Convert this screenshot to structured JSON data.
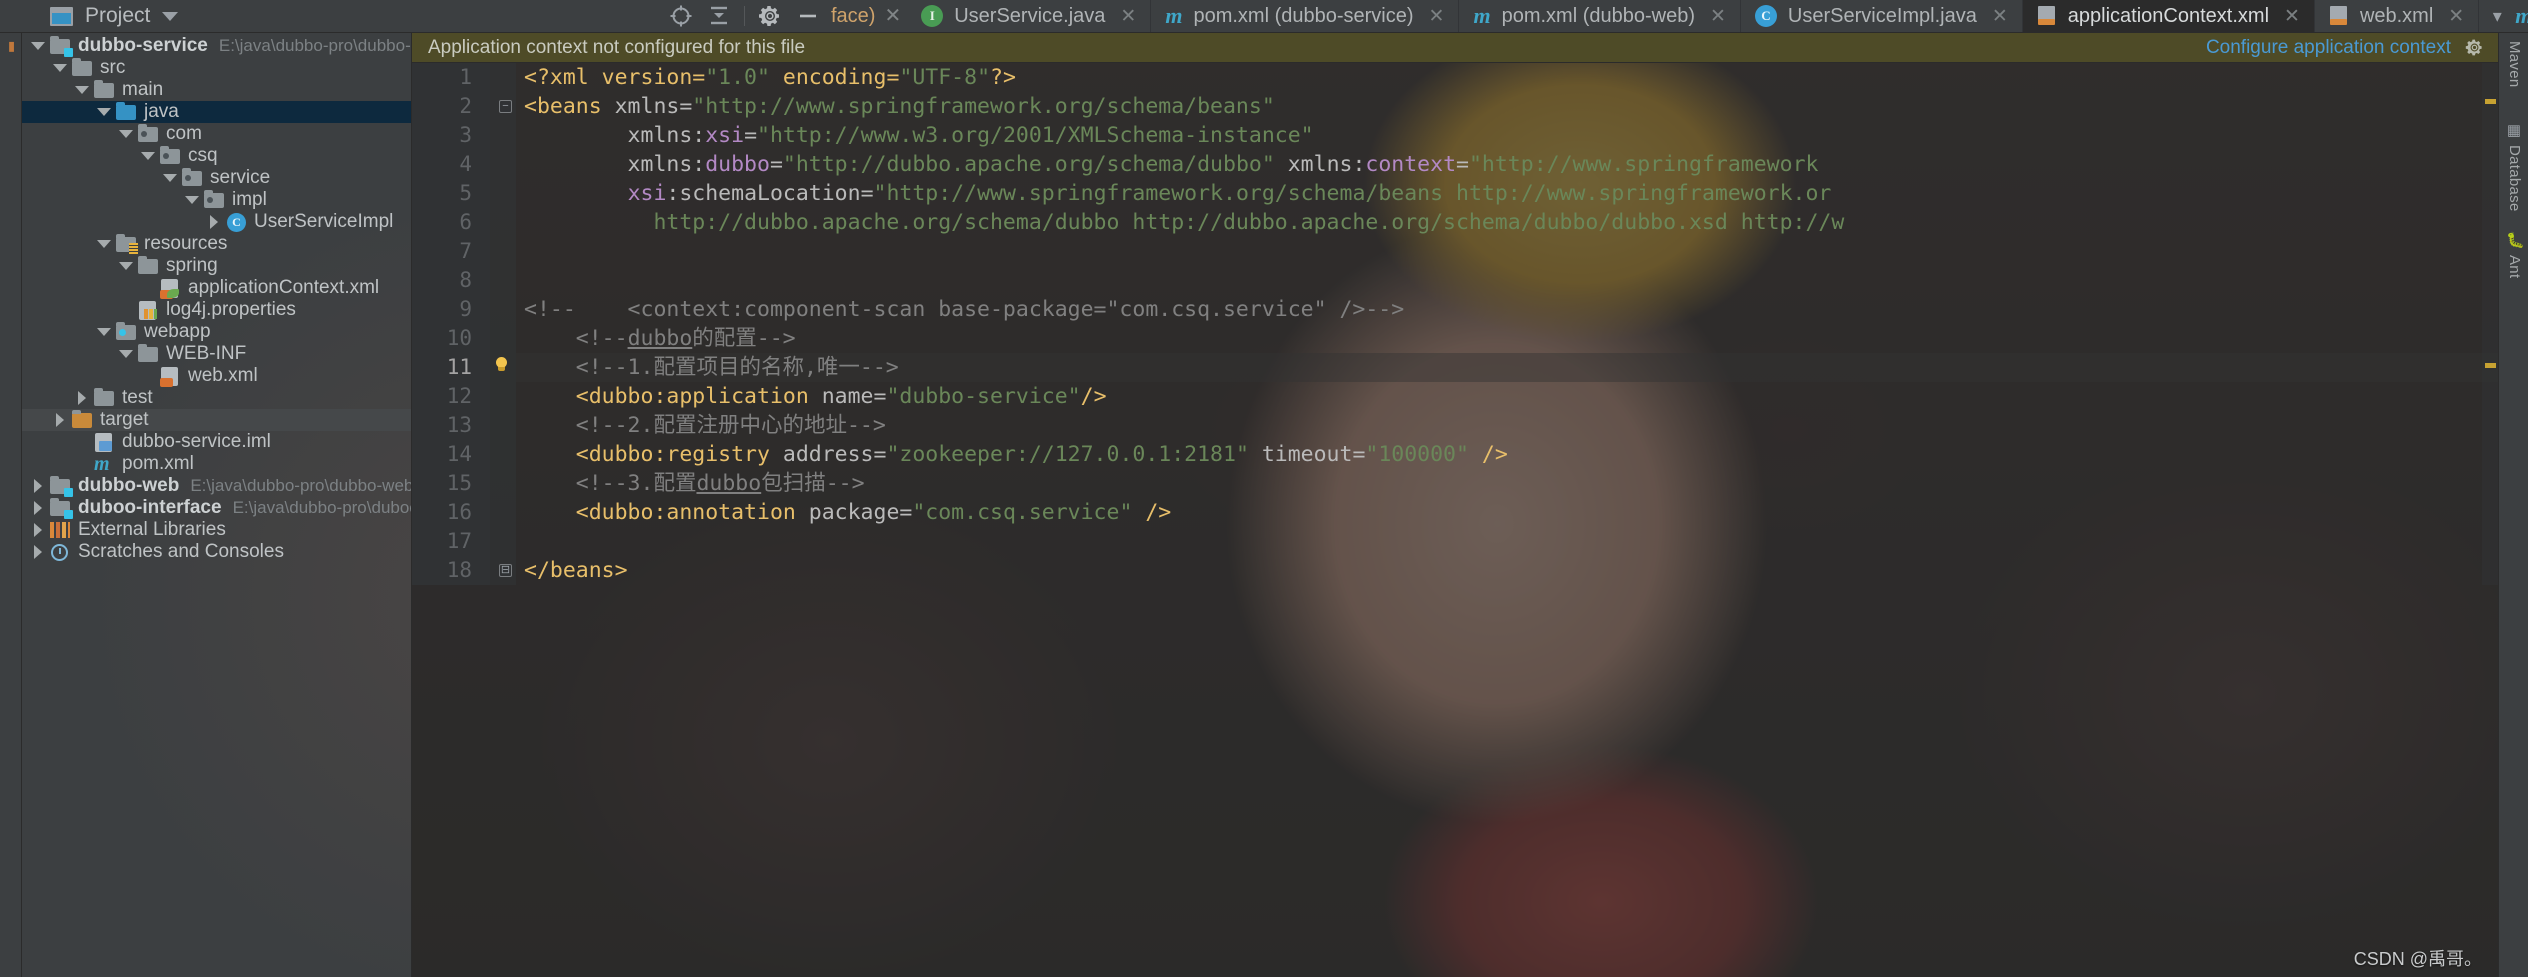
{
  "toolbar": {
    "project_button_label": "Project",
    "icons": [
      {
        "name": "locate-icon",
        "glyph": "target"
      },
      {
        "name": "collapse-all-icon",
        "glyph": "collapse"
      },
      {
        "name": "settings-gear-icon",
        "glyph": "gear"
      },
      {
        "name": "hide-icon",
        "glyph": "minus"
      }
    ],
    "clipped_tab_label": "face)"
  },
  "tabs": [
    {
      "label": "UserService.java",
      "icon": "java-interface-icon",
      "icon_kind": "java",
      "active": false
    },
    {
      "label": "pom.xml (dubbo-service)",
      "icon": "maven-icon",
      "icon_kind": "maven",
      "active": false
    },
    {
      "label": "pom.xml (dubbo-web)",
      "icon": "maven-icon",
      "icon_kind": "maven",
      "active": false
    },
    {
      "label": "UserServiceImpl.java",
      "icon": "java-class-icon",
      "icon_kind": "class",
      "active": false
    },
    {
      "label": "applicationContext.xml",
      "icon": "xml-file-icon",
      "icon_kind": "xml",
      "active": true
    },
    {
      "label": "web.xml",
      "icon": "xml-file-icon",
      "icon_kind": "xml",
      "active": false
    }
  ],
  "tabs_overflow_icon": "chevron-down-icon",
  "notification": {
    "message": "Application context not configured for this file",
    "link": "Configure application context",
    "gear_icon": "gear-icon",
    "background_color": "#4e4b27",
    "link_color": "#4a9ad4"
  },
  "sidebar": {
    "title": "Project",
    "rows": [
      {
        "depth": 0,
        "arrow": "down",
        "icon": "module-folder-icon",
        "label": "dubbo-service",
        "bold": true,
        "path": "E:\\java\\dubbo-pro\\dubbo-service",
        "state": "normal"
      },
      {
        "depth": 1,
        "arrow": "down",
        "icon": "folder-icon",
        "label": "src",
        "state": "normal"
      },
      {
        "depth": 2,
        "arrow": "down",
        "icon": "folder-icon",
        "label": "main",
        "state": "normal"
      },
      {
        "depth": 3,
        "arrow": "down",
        "icon": "source-folder-icon",
        "label": "java",
        "state": "selected"
      },
      {
        "depth": 4,
        "arrow": "down",
        "icon": "package-folder-icon",
        "label": "com",
        "state": "normal"
      },
      {
        "depth": 5,
        "arrow": "down",
        "icon": "package-folder-icon",
        "label": "csq",
        "state": "normal"
      },
      {
        "depth": 6,
        "arrow": "down",
        "icon": "package-folder-icon",
        "label": "service",
        "state": "normal"
      },
      {
        "depth": 7,
        "arrow": "down",
        "icon": "package-folder-icon",
        "label": "impl",
        "state": "normal"
      },
      {
        "depth": 8,
        "arrow": "right",
        "icon": "java-class-icon",
        "label": "UserServiceImpl",
        "state": "normal"
      },
      {
        "depth": 3,
        "arrow": "down",
        "icon": "resource-folder-icon",
        "label": "resources",
        "state": "normal"
      },
      {
        "depth": 4,
        "arrow": "down",
        "icon": "folder-icon",
        "label": "spring",
        "state": "normal"
      },
      {
        "depth": 5,
        "arrow": "none",
        "icon": "spring-xml-icon",
        "label": "applicationContext.xml",
        "state": "normal"
      },
      {
        "depth": 4,
        "arrow": "none",
        "icon": "properties-file-icon",
        "label": "log4j.properties",
        "state": "normal"
      },
      {
        "depth": 3,
        "arrow": "down",
        "icon": "webapp-folder-icon",
        "label": "webapp",
        "state": "normal"
      },
      {
        "depth": 4,
        "arrow": "down",
        "icon": "folder-icon",
        "label": "WEB-INF",
        "state": "normal"
      },
      {
        "depth": 5,
        "arrow": "none",
        "icon": "xml-file-icon",
        "label": "web.xml",
        "state": "normal"
      },
      {
        "depth": 2,
        "arrow": "right",
        "icon": "folder-icon",
        "label": "test",
        "state": "normal"
      },
      {
        "depth": 1,
        "arrow": "right",
        "icon": "folder-icon",
        "label": "target",
        "state": "highlighted"
      },
      {
        "depth": 1,
        "arrow": "none",
        "icon": "iml-file-icon",
        "label": "dubbo-service.iml",
        "state": "normal"
      },
      {
        "depth": 1,
        "arrow": "none",
        "icon": "maven-icon",
        "label": "pom.xml",
        "state": "normal"
      },
      {
        "depth": 0,
        "arrow": "right",
        "icon": "module-folder-icon",
        "label": "dubbo-web",
        "bold": true,
        "path": "E:\\java\\dubbo-pro\\dubbo-web",
        "state": "normal"
      },
      {
        "depth": 0,
        "arrow": "right",
        "icon": "module-folder-icon",
        "label": "duboo-interface",
        "bold": true,
        "path": "E:\\java\\dubbo-pro\\duboo-interface",
        "state": "normal"
      },
      {
        "depth": 0,
        "arrow": "right",
        "icon": "external-libraries-icon",
        "label": "External Libraries",
        "state": "normal"
      },
      {
        "depth": 0,
        "arrow": "right",
        "icon": "scratches-icon",
        "label": "Scratches and Consoles",
        "state": "normal"
      }
    ]
  },
  "editor": {
    "filename": "applicationContext.xml",
    "lines": [
      {
        "n": 1,
        "tokens": [
          {
            "t": "<?xml version=",
            "c": "tag"
          },
          {
            "t": "\"1.0\"",
            "c": "str"
          },
          {
            "t": " encoding=",
            "c": "tag"
          },
          {
            "t": "\"UTF-8\"",
            "c": "str"
          },
          {
            "t": "?>",
            "c": "tag"
          }
        ]
      },
      {
        "n": 2,
        "tokens": [
          {
            "t": "<beans ",
            "c": "tag"
          },
          {
            "t": "xmlns=",
            "c": "attr"
          },
          {
            "t": "\"http://www.springframework.org/schema/beans\"",
            "c": "str"
          }
        ]
      },
      {
        "n": 3,
        "tokens": [
          {
            "t": "        xmlns:",
            "c": "attr"
          },
          {
            "t": "xsi",
            "c": "ns"
          },
          {
            "t": "=",
            "c": "attr"
          },
          {
            "t": "\"http://www.w3.org/2001/XMLSchema-instance\"",
            "c": "str"
          }
        ]
      },
      {
        "n": 4,
        "tokens": [
          {
            "t": "        xmlns:",
            "c": "attr"
          },
          {
            "t": "dubbo",
            "c": "ns"
          },
          {
            "t": "=",
            "c": "attr"
          },
          {
            "t": "\"http://dubbo.apache.org/schema/dubbo\"",
            "c": "str"
          },
          {
            "t": " xmlns:",
            "c": "attr"
          },
          {
            "t": "context",
            "c": "ns"
          },
          {
            "t": "=",
            "c": "attr"
          },
          {
            "t": "\"http://www.springframework",
            "c": "str"
          }
        ]
      },
      {
        "n": 5,
        "tokens": [
          {
            "t": "        ",
            "c": "attr"
          },
          {
            "t": "xsi",
            "c": "ns"
          },
          {
            "t": ":schemaLocation=",
            "c": "attr"
          },
          {
            "t": "\"http://www.springframework.org/schema/beans http://www.springframework.or",
            "c": "str"
          }
        ]
      },
      {
        "n": 6,
        "tokens": [
          {
            "t": "          http://dubbo.apache.org/schema/dubbo http://dubbo.apache.org/schema/dubbo/dubbo.xsd http://w",
            "c": "str"
          }
        ]
      },
      {
        "n": 7,
        "tokens": []
      },
      {
        "n": 8,
        "tokens": []
      },
      {
        "n": 9,
        "tokens": [
          {
            "t": "<!--    <context:component-scan base-package=\"com.csq.service\" />-->",
            "c": "cmt"
          }
        ]
      },
      {
        "n": 10,
        "tokens": [
          {
            "t": "    <!--dubbo的配置-->",
            "c": "cmt",
            "underline": "dubbo"
          }
        ]
      },
      {
        "n": 11,
        "tokens": [
          {
            "t": "    <!--1.配置项目的名称,唯一-->",
            "c": "cmt"
          }
        ],
        "bulb": true,
        "current": true
      },
      {
        "n": 12,
        "tokens": [
          {
            "t": "    <dubbo:application ",
            "c": "tag"
          },
          {
            "t": "name=",
            "c": "attr"
          },
          {
            "t": "\"dubbo-service\"",
            "c": "str"
          },
          {
            "t": "/>",
            "c": "tag"
          }
        ]
      },
      {
        "n": 13,
        "tokens": [
          {
            "t": "    <!--2.配置注册中心的地址-->",
            "c": "cmt"
          }
        ]
      },
      {
        "n": 14,
        "tokens": [
          {
            "t": "    <dubbo:registry ",
            "c": "tag"
          },
          {
            "t": "address=",
            "c": "attr"
          },
          {
            "t": "\"zookeeper://127.0.0.1:2181\"",
            "c": "str"
          },
          {
            "t": " timeout=",
            "c": "attr"
          },
          {
            "t": "\"100000\"",
            "c": "str"
          },
          {
            "t": " />",
            "c": "tag"
          }
        ]
      },
      {
        "n": 15,
        "tokens": [
          {
            "t": "    <!--3.配置dubbo包扫描-->",
            "c": "cmt",
            "underline": "dubbo"
          }
        ]
      },
      {
        "n": 16,
        "tokens": [
          {
            "t": "    <dubbo:annotation ",
            "c": "tag"
          },
          {
            "t": "package=",
            "c": "attr"
          },
          {
            "t": "\"com.csq.service\"",
            "c": "str"
          },
          {
            "t": " />",
            "c": "tag"
          }
        ]
      },
      {
        "n": 17,
        "tokens": []
      },
      {
        "n": 18,
        "tokens": [
          {
            "t": "</beans>",
            "c": "tag"
          }
        ]
      }
    ]
  },
  "right_strip": {
    "items": [
      "Maven",
      "Database",
      "Ant"
    ]
  },
  "watermark": "CSDN @禹哥。"
}
